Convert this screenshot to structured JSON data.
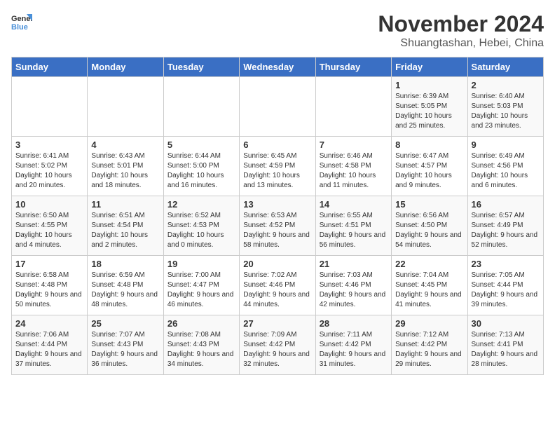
{
  "logo": {
    "text_general": "General",
    "text_blue": "Blue"
  },
  "title": "November 2024",
  "subtitle": "Shuangtashan, Hebei, China",
  "headers": [
    "Sunday",
    "Monday",
    "Tuesday",
    "Wednesday",
    "Thursday",
    "Friday",
    "Saturday"
  ],
  "weeks": [
    [
      {
        "day": "",
        "info": ""
      },
      {
        "day": "",
        "info": ""
      },
      {
        "day": "",
        "info": ""
      },
      {
        "day": "",
        "info": ""
      },
      {
        "day": "",
        "info": ""
      },
      {
        "day": "1",
        "info": "Sunrise: 6:39 AM\nSunset: 5:05 PM\nDaylight: 10 hours and 25 minutes."
      },
      {
        "day": "2",
        "info": "Sunrise: 6:40 AM\nSunset: 5:03 PM\nDaylight: 10 hours and 23 minutes."
      }
    ],
    [
      {
        "day": "3",
        "info": "Sunrise: 6:41 AM\nSunset: 5:02 PM\nDaylight: 10 hours and 20 minutes."
      },
      {
        "day": "4",
        "info": "Sunrise: 6:43 AM\nSunset: 5:01 PM\nDaylight: 10 hours and 18 minutes."
      },
      {
        "day": "5",
        "info": "Sunrise: 6:44 AM\nSunset: 5:00 PM\nDaylight: 10 hours and 16 minutes."
      },
      {
        "day": "6",
        "info": "Sunrise: 6:45 AM\nSunset: 4:59 PM\nDaylight: 10 hours and 13 minutes."
      },
      {
        "day": "7",
        "info": "Sunrise: 6:46 AM\nSunset: 4:58 PM\nDaylight: 10 hours and 11 minutes."
      },
      {
        "day": "8",
        "info": "Sunrise: 6:47 AM\nSunset: 4:57 PM\nDaylight: 10 hours and 9 minutes."
      },
      {
        "day": "9",
        "info": "Sunrise: 6:49 AM\nSunset: 4:56 PM\nDaylight: 10 hours and 6 minutes."
      }
    ],
    [
      {
        "day": "10",
        "info": "Sunrise: 6:50 AM\nSunset: 4:55 PM\nDaylight: 10 hours and 4 minutes."
      },
      {
        "day": "11",
        "info": "Sunrise: 6:51 AM\nSunset: 4:54 PM\nDaylight: 10 hours and 2 minutes."
      },
      {
        "day": "12",
        "info": "Sunrise: 6:52 AM\nSunset: 4:53 PM\nDaylight: 10 hours and 0 minutes."
      },
      {
        "day": "13",
        "info": "Sunrise: 6:53 AM\nSunset: 4:52 PM\nDaylight: 9 hours and 58 minutes."
      },
      {
        "day": "14",
        "info": "Sunrise: 6:55 AM\nSunset: 4:51 PM\nDaylight: 9 hours and 56 minutes."
      },
      {
        "day": "15",
        "info": "Sunrise: 6:56 AM\nSunset: 4:50 PM\nDaylight: 9 hours and 54 minutes."
      },
      {
        "day": "16",
        "info": "Sunrise: 6:57 AM\nSunset: 4:49 PM\nDaylight: 9 hours and 52 minutes."
      }
    ],
    [
      {
        "day": "17",
        "info": "Sunrise: 6:58 AM\nSunset: 4:48 PM\nDaylight: 9 hours and 50 minutes."
      },
      {
        "day": "18",
        "info": "Sunrise: 6:59 AM\nSunset: 4:48 PM\nDaylight: 9 hours and 48 minutes."
      },
      {
        "day": "19",
        "info": "Sunrise: 7:00 AM\nSunset: 4:47 PM\nDaylight: 9 hours and 46 minutes."
      },
      {
        "day": "20",
        "info": "Sunrise: 7:02 AM\nSunset: 4:46 PM\nDaylight: 9 hours and 44 minutes."
      },
      {
        "day": "21",
        "info": "Sunrise: 7:03 AM\nSunset: 4:46 PM\nDaylight: 9 hours and 42 minutes."
      },
      {
        "day": "22",
        "info": "Sunrise: 7:04 AM\nSunset: 4:45 PM\nDaylight: 9 hours and 41 minutes."
      },
      {
        "day": "23",
        "info": "Sunrise: 7:05 AM\nSunset: 4:44 PM\nDaylight: 9 hours and 39 minutes."
      }
    ],
    [
      {
        "day": "24",
        "info": "Sunrise: 7:06 AM\nSunset: 4:44 PM\nDaylight: 9 hours and 37 minutes."
      },
      {
        "day": "25",
        "info": "Sunrise: 7:07 AM\nSunset: 4:43 PM\nDaylight: 9 hours and 36 minutes."
      },
      {
        "day": "26",
        "info": "Sunrise: 7:08 AM\nSunset: 4:43 PM\nDaylight: 9 hours and 34 minutes."
      },
      {
        "day": "27",
        "info": "Sunrise: 7:09 AM\nSunset: 4:42 PM\nDaylight: 9 hours and 32 minutes."
      },
      {
        "day": "28",
        "info": "Sunrise: 7:11 AM\nSunset: 4:42 PM\nDaylight: 9 hours and 31 minutes."
      },
      {
        "day": "29",
        "info": "Sunrise: 7:12 AM\nSunset: 4:42 PM\nDaylight: 9 hours and 29 minutes."
      },
      {
        "day": "30",
        "info": "Sunrise: 7:13 AM\nSunset: 4:41 PM\nDaylight: 9 hours and 28 minutes."
      }
    ]
  ]
}
